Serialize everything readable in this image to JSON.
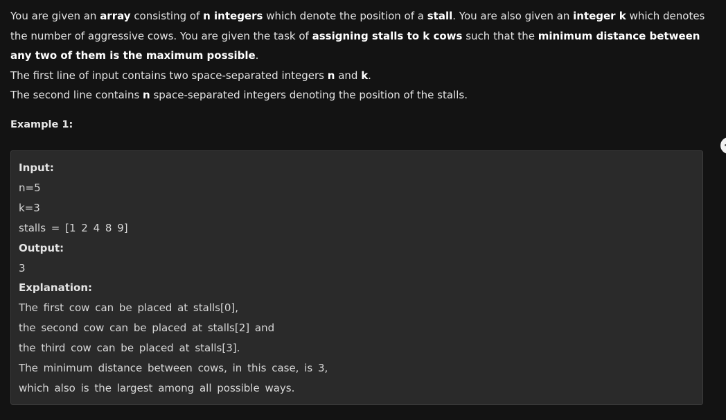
{
  "problem": {
    "line1": {
      "t1": "You are given an ",
      "b1": "array",
      "t2": " consisting of ",
      "b2": "n integers",
      "t3": " which denote the position of a ",
      "b3": "stall",
      "t4": ". You are also given an ",
      "b4": "integer k",
      "t5": " which denotes the number of aggressive cows. You are given the task of ",
      "b5": "assigning stalls to k cows",
      "t6": " such that the ",
      "b6": "minimum distance between any two of them is the maximum possible",
      "t7": "."
    },
    "line2": {
      "t1": "The first line of input contains two space-separated integers ",
      "b1": "n",
      "t2": " and ",
      "b2": "k",
      "t3": "."
    },
    "line3": {
      "t1": "The second line contains ",
      "b1": "n",
      "t2": " space-separated integers denoting the position of the stalls."
    }
  },
  "example": {
    "heading": "Example 1:",
    "input_label": "Input:",
    "input_lines": [
      "n=5",
      "k=3",
      "stalls = [1 2 4 8 9]"
    ],
    "output_label": "Output:",
    "output_value": "3",
    "explanation_label": "Explanation:",
    "explanation_lines": [
      "The first cow can be placed at stalls[0],",
      "the second cow can be placed at stalls[2] and",
      "the third cow can be placed at stalls[3].",
      "The minimum distance between cows, in this case, is 3,",
      "which also is the largest among all possible ways."
    ]
  }
}
